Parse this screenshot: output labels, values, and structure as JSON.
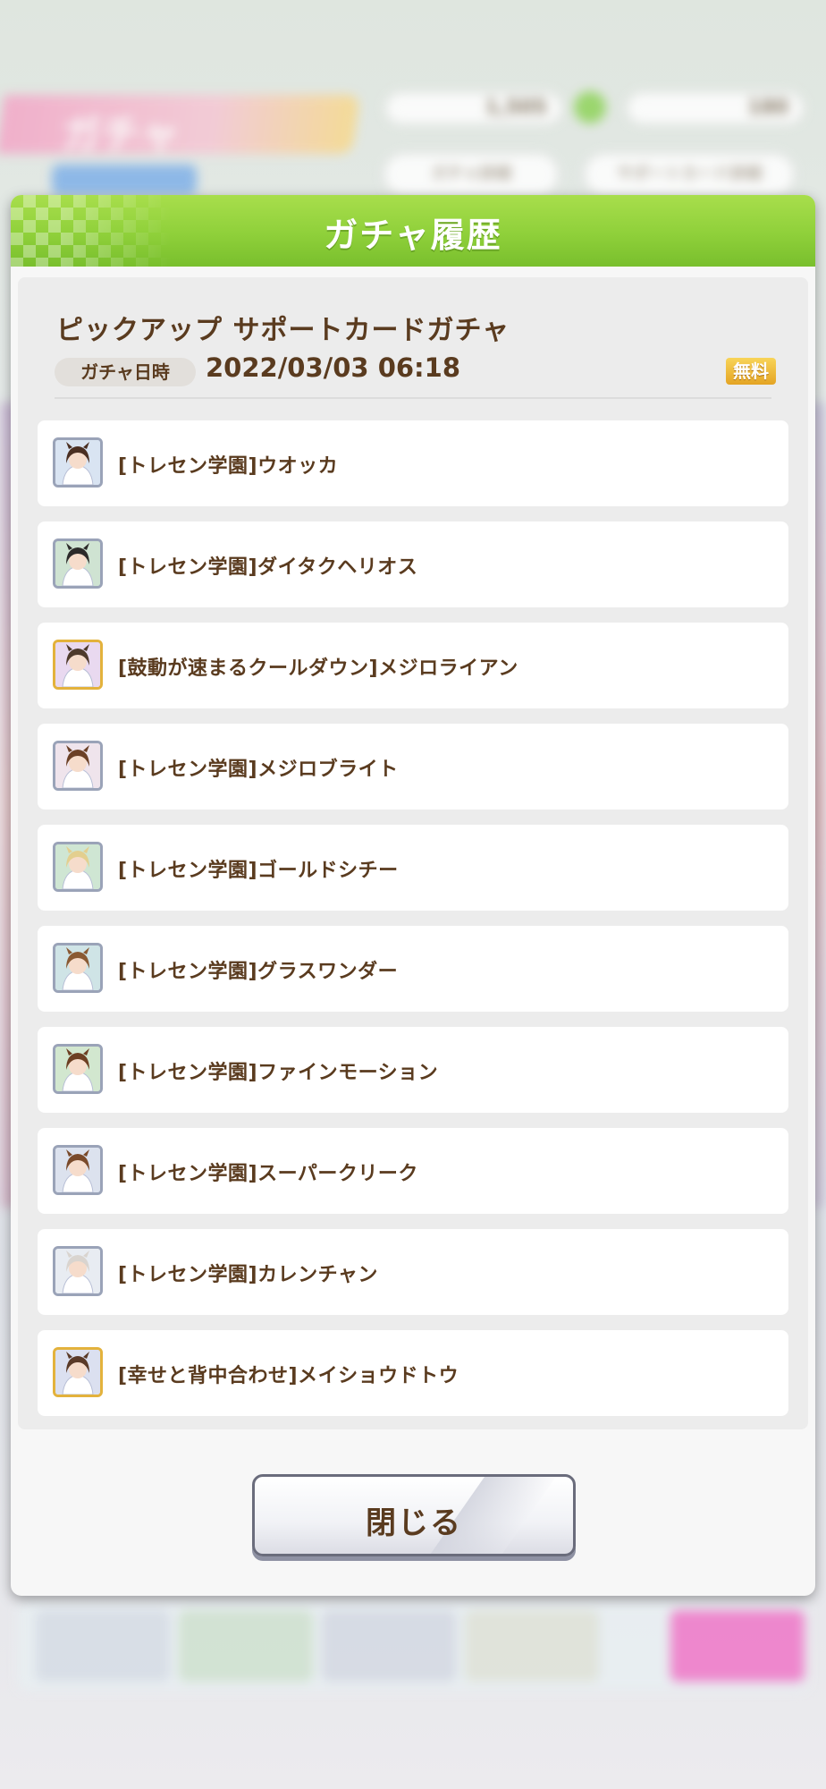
{
  "background": {
    "screen_title": "ガチャ",
    "currency_1": "1,505",
    "currency_2": "180",
    "tab_1": "ガチャ詳細",
    "tab_2": "サポートカード詳細"
  },
  "dialog": {
    "title": "ガチャ履歴",
    "gacha_name": "ピックアップ サポートカードガチャ",
    "date_label": "ガチャ日時",
    "date_value": "2022/03/03 06:18",
    "free_badge": "無料",
    "close_label": "閉じる",
    "results": [
      {
        "label": "[トレセン学園]ウオッカ",
        "rarity": "R",
        "frame_color": "#9aa3b8",
        "bg_color": "#d9e4f2",
        "hair_color": "#4a2f22"
      },
      {
        "label": "[トレセン学園]ダイタクヘリオス",
        "rarity": "R",
        "frame_color": "#9aa3b8",
        "bg_color": "#cfe3d2",
        "hair_color": "#2c2a2a"
      },
      {
        "label": "[鼓動が速まるクールダウン]メジロライアン",
        "rarity": "SSR",
        "frame_color": "#e3b23c",
        "bg_color": "#e9d9f0",
        "hair_color": "#4e3a2c"
      },
      {
        "label": "[トレセン学園]メジロブライト",
        "rarity": "R",
        "frame_color": "#9aa3b8",
        "bg_color": "#efe4ec",
        "hair_color": "#6b4026"
      },
      {
        "label": "[トレセン学園]ゴールドシチー",
        "rarity": "R",
        "frame_color": "#9aa3b8",
        "bg_color": "#cfe6d3",
        "hair_color": "#e3cf8f"
      },
      {
        "label": "[トレセン学園]グラスワンダー",
        "rarity": "R",
        "frame_color": "#9aa3b8",
        "bg_color": "#cfe4e6",
        "hair_color": "#8a5a33"
      },
      {
        "label": "[トレセン学園]ファインモーション",
        "rarity": "R",
        "frame_color": "#9aa3b8",
        "bg_color": "#d2e7cf",
        "hair_color": "#6d3f22"
      },
      {
        "label": "[トレセン学園]スーパークリーク",
        "rarity": "R",
        "frame_color": "#9aa3b8",
        "bg_color": "#dce2ee",
        "hair_color": "#7a4a2a"
      },
      {
        "label": "[トレセン学園]カレンチャン",
        "rarity": "R",
        "frame_color": "#9aa3b8",
        "bg_color": "#e8ecf2",
        "hair_color": "#d9d4cf"
      },
      {
        "label": "[幸せと背中合わせ]メイショウドトウ",
        "rarity": "SSR",
        "frame_color": "#e3b23c",
        "bg_color": "#dbe0f0",
        "hair_color": "#5a3a28"
      }
    ]
  }
}
